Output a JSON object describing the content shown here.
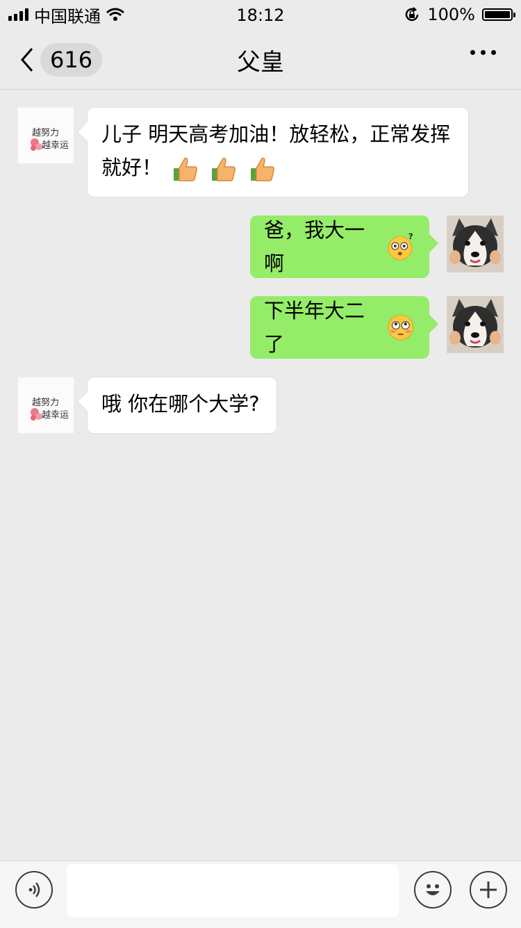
{
  "status_bar": {
    "carrier": "中国联通",
    "time": "18:12",
    "battery": "100%"
  },
  "nav": {
    "back_count": "616",
    "title": "父皇"
  },
  "messages": [
    {
      "side": "left",
      "sender": "father",
      "text_line1": "儿子 明天高考加油！放轻松，正常发挥",
      "text_line2": "就好！",
      "emojis": [
        "thumbs-up",
        "thumbs-up",
        "thumbs-up"
      ]
    },
    {
      "side": "right",
      "sender": "me",
      "text": "爸，我大一啊",
      "emojis": [
        "dizzy-face"
      ]
    },
    {
      "side": "right",
      "sender": "me",
      "text": "下半年大二了",
      "emojis": [
        "flushed-face"
      ]
    },
    {
      "side": "left",
      "sender": "father",
      "text": "哦 你在哪个大学?"
    }
  ],
  "father_avatar_text": [
    "越努力",
    "越幸运"
  ],
  "input": {
    "placeholder": ""
  },
  "colors": {
    "background": "#ebebeb",
    "bubble_right": "#95ec69",
    "bubble_left": "#ffffff"
  }
}
